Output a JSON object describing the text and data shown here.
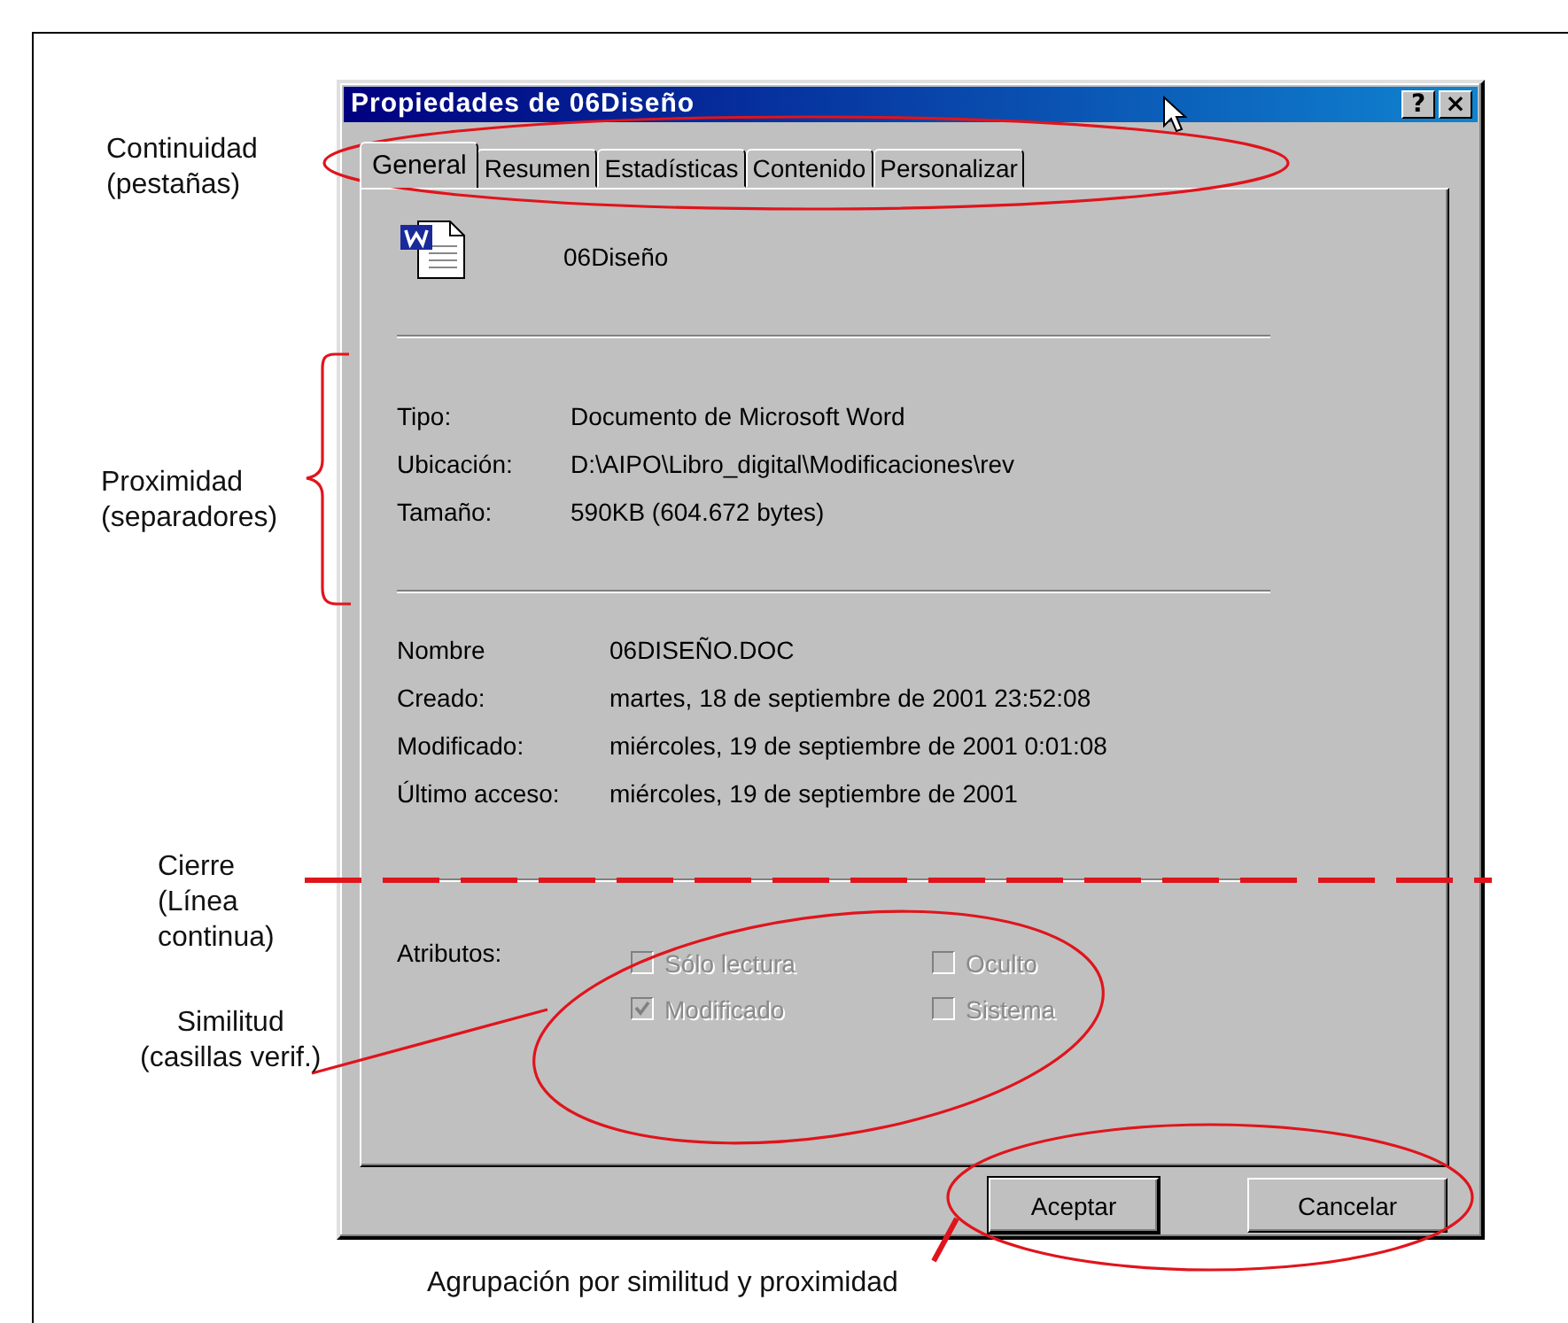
{
  "dialog": {
    "title": "Propiedades de 06Diseño",
    "title_buttons": [
      "?",
      "×"
    ],
    "tabs": [
      {
        "label": "General",
        "selected": true
      },
      {
        "label": "Resumen",
        "selected": false
      },
      {
        "label": "Estadísticas",
        "selected": false
      },
      {
        "label": "Contenido",
        "selected": false
      },
      {
        "label": "Personalizar",
        "selected": false
      }
    ],
    "file_name": "06Diseño",
    "info": [
      {
        "label": "Tipo:",
        "value": "Documento de Microsoft Word"
      },
      {
        "label": "Ubicación:",
        "value": "D:\\AIPO\\Libro_digital\\Modificaciones\\rev"
      },
      {
        "label": "Tamaño:",
        "value": "590KB (604.672 bytes)"
      }
    ],
    "dates": [
      {
        "label": "Nombre",
        "value": "06DISEÑO.DOC"
      },
      {
        "label": "Creado:",
        "value": "martes, 18 de septiembre de 2001 23:52:08"
      },
      {
        "label": "Modificado:",
        "value": "miércoles, 19 de septiembre de 2001 0:01:08"
      },
      {
        "label": "Último acceso:",
        "value": "miércoles, 19 de septiembre de 2001"
      }
    ],
    "attributes_label": "Atributos:",
    "attributes": [
      {
        "label": "Sólo lectura",
        "checked": false,
        "disabled": true
      },
      {
        "label": "Oculto",
        "checked": false,
        "disabled": true
      },
      {
        "label": "Modificado",
        "checked": true,
        "disabled": true
      },
      {
        "label": "Sistema",
        "checked": false,
        "disabled": true
      }
    ],
    "buttons": [
      "Aceptar",
      "Cancelar"
    ]
  },
  "annotations": [
    {
      "kind": "tabs-ellipse",
      "text": "Continuidad\n(pestañas)"
    },
    {
      "kind": "brace",
      "text": "Proximidad\n(separadores)"
    },
    {
      "kind": "dashed-line",
      "text": "Cierre\n(Línea\ncontinua)"
    },
    {
      "kind": "checkbox-ellipse",
      "text": "Similitud\n(casillas verif.)"
    },
    {
      "kind": "button-ellipse",
      "text": "Agrupación por similitud y proximidad"
    }
  ]
}
